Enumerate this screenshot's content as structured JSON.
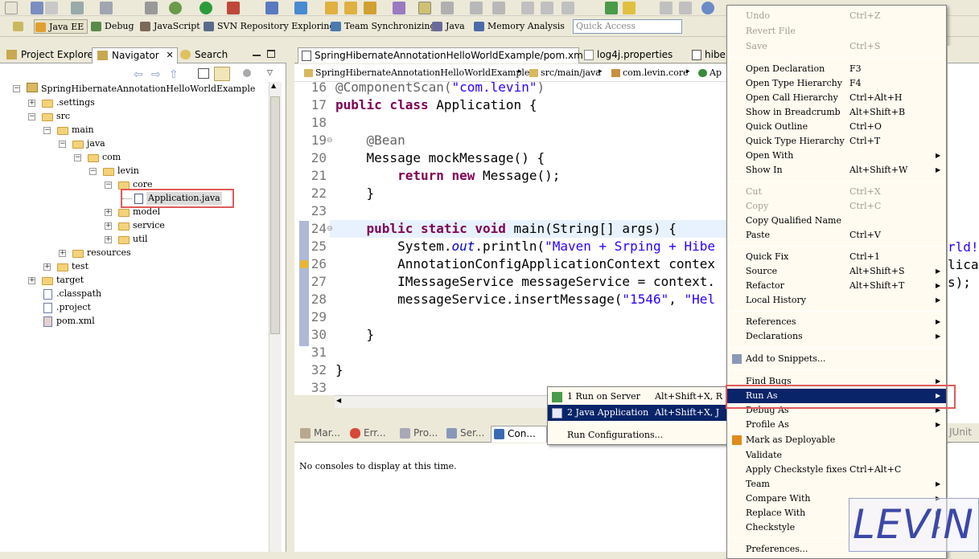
{
  "perspectives": {
    "items": [
      {
        "label": "Java EE"
      },
      {
        "label": "Debug"
      },
      {
        "label": "JavaScript"
      },
      {
        "label": "SVN Repository Exploring"
      },
      {
        "label": "Team Synchronizing"
      },
      {
        "label": "Java"
      },
      {
        "label": "Memory Analysis"
      }
    ],
    "quick_access_placeholder": "Quick Access"
  },
  "left_panel": {
    "tabs": [
      "Project Explorer",
      "Navigator",
      "Search"
    ],
    "tree": [
      {
        "label": "SpringHibernateAnnotationHelloWorldExample"
      },
      {
        "label": ".settings"
      },
      {
        "label": "src"
      },
      {
        "label": "main"
      },
      {
        "label": "java"
      },
      {
        "label": "com"
      },
      {
        "label": "levin"
      },
      {
        "label": "core"
      },
      {
        "label": "Application.java"
      },
      {
        "label": "model"
      },
      {
        "label": "service"
      },
      {
        "label": "util"
      },
      {
        "label": "resources"
      },
      {
        "label": "test"
      },
      {
        "label": "target"
      },
      {
        "label": ".classpath"
      },
      {
        "label": ".project"
      },
      {
        "label": "pom.xml"
      }
    ]
  },
  "editor": {
    "tabs": [
      "SpringHibernateAnnotationHelloWorldExample/pom.xml",
      "log4j.properties",
      "hiber"
    ],
    "breadcrumb": [
      "SpringHibernateAnnotationHelloWorldExample",
      "src/main/java",
      "com.levin.core",
      "Ap"
    ],
    "line_numbers": [
      "16",
      "17",
      "18",
      "19",
      "20",
      "21",
      "22",
      "23",
      "24",
      "25",
      "26",
      "27",
      "28",
      "29",
      "30",
      "31",
      "32",
      "33"
    ]
  },
  "bottom_panel": {
    "tabs": [
      "Mar...",
      "Err...",
      "Pro...",
      "Ser...",
      "Con..."
    ],
    "extra_tab": "JUnit",
    "console_message": "No consoles to display at this time."
  },
  "submenu": {
    "items": [
      {
        "label": "1 Run on Server",
        "shortcut": "Alt+Shift+X, R"
      },
      {
        "label": "2 Java Application",
        "shortcut": "Alt+Shift+X, J"
      },
      {
        "label": "Run Configurations..."
      }
    ]
  },
  "context_menu": {
    "items": [
      {
        "label": "Undo",
        "shortcut": "Ctrl+Z"
      },
      {
        "label": "Revert File"
      },
      {
        "label": "Save",
        "shortcut": "Ctrl+S"
      },
      {
        "label": "Open Declaration",
        "shortcut": "F3"
      },
      {
        "label": "Open Type Hierarchy",
        "shortcut": "F4"
      },
      {
        "label": "Open Call Hierarchy",
        "shortcut": "Ctrl+Alt+H"
      },
      {
        "label": "Show in Breadcrumb",
        "shortcut": "Alt+Shift+B"
      },
      {
        "label": "Quick Outline",
        "shortcut": "Ctrl+O"
      },
      {
        "label": "Quick Type Hierarchy",
        "shortcut": "Ctrl+T"
      },
      {
        "label": "Open With"
      },
      {
        "label": "Show In",
        "shortcut": "Alt+Shift+W"
      },
      {
        "label": "Cut",
        "shortcut": "Ctrl+X"
      },
      {
        "label": "Copy",
        "shortcut": "Ctrl+C"
      },
      {
        "label": "Copy Qualified Name"
      },
      {
        "label": "Paste",
        "shortcut": "Ctrl+V"
      },
      {
        "label": "Quick Fix",
        "shortcut": "Ctrl+1"
      },
      {
        "label": "Source",
        "shortcut": "Alt+Shift+S"
      },
      {
        "label": "Refactor",
        "shortcut": "Alt+Shift+T"
      },
      {
        "label": "Local History"
      },
      {
        "label": "References"
      },
      {
        "label": "Declarations"
      },
      {
        "label": "Add to Snippets..."
      },
      {
        "label": "Find Bugs"
      },
      {
        "label": "Run As"
      },
      {
        "label": "Debug As"
      },
      {
        "label": "Profile As"
      },
      {
        "label": "Mark as Deployable"
      },
      {
        "label": "Validate"
      },
      {
        "label": "Apply Checkstyle fixes",
        "shortcut": "Ctrl+Alt+C"
      },
      {
        "label": "Team"
      },
      {
        "label": "Compare With"
      },
      {
        "label": "Replace With"
      },
      {
        "label": "Checkstyle"
      },
      {
        "label": "Preferences..."
      }
    ]
  },
  "watermark": "LEVIN"
}
